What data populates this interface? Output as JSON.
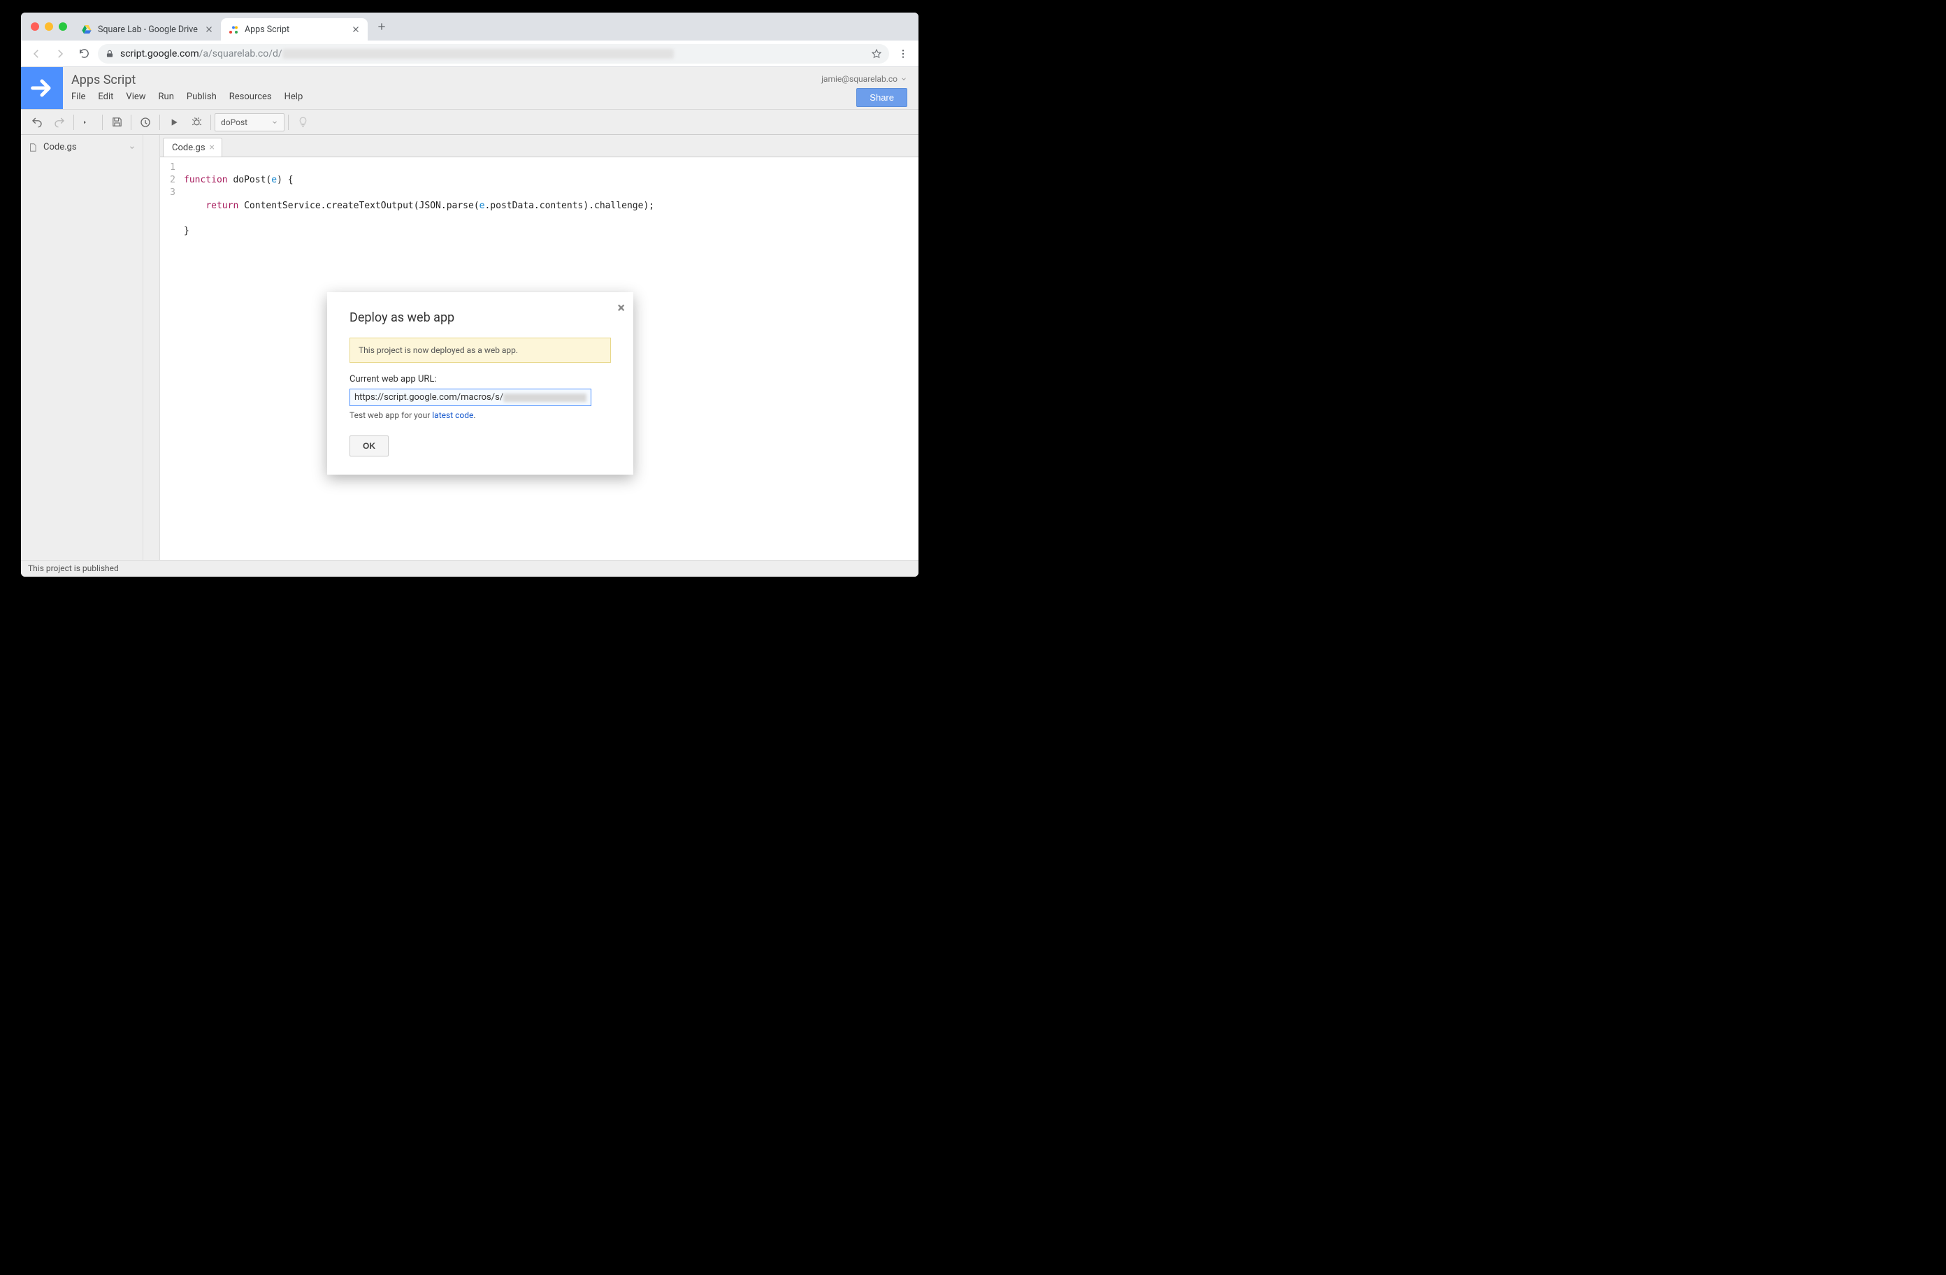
{
  "browser": {
    "tabs": [
      {
        "title": "Square Lab - Google Drive"
      },
      {
        "title": "Apps Script"
      }
    ],
    "url_host": "script.google.com",
    "url_path": "/a/squarelab.co/d/"
  },
  "header": {
    "app_title": "Apps Script",
    "menus": [
      "File",
      "Edit",
      "View",
      "Run",
      "Publish",
      "Resources",
      "Help"
    ],
    "user_email": "jamie@squarelab.co",
    "share_label": "Share"
  },
  "toolbar": {
    "function_selected": "doPost"
  },
  "sidebar": {
    "files": [
      "Code.gs"
    ]
  },
  "editor": {
    "open_tab": "Code.gs",
    "lines": [
      "1",
      "2",
      "3"
    ]
  },
  "code": {
    "l1a": "function",
    "l1b": " doPost(",
    "l1c": "e",
    "l1d": ") {",
    "l2a": "    ",
    "l2b": "return",
    "l2c": " ContentService.createTextOutput(JSON.parse(",
    "l2d": "e",
    "l2e": ".postData.contents).challenge);",
    "l3": "}"
  },
  "dialog": {
    "title": "Deploy as web app",
    "notice": "This project is now deployed as a web app.",
    "url_label": "Current web app URL:",
    "url_value": "https://script.google.com/macros/s/",
    "hint_prefix": "Test web app for your ",
    "hint_link": "latest code",
    "hint_suffix": ".",
    "ok": "OK"
  },
  "status": "This project is published"
}
